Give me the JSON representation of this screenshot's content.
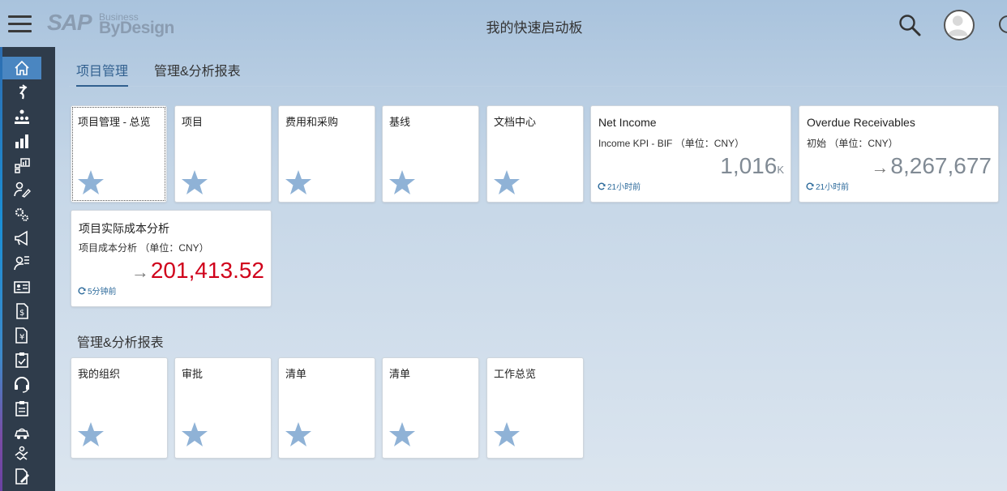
{
  "header": {
    "logo_brand": "SAP",
    "logo_business": "Business",
    "logo_product": "ByDesign",
    "page_title": "我的快速启动板"
  },
  "tabs": [
    {
      "label": "项目管理",
      "active": true
    },
    {
      "label": "管理&分析报表",
      "active": false
    }
  ],
  "tiles_row1": [
    {
      "label": "项目管理 - 总览"
    },
    {
      "label": "项目"
    },
    {
      "label": "费用和采购"
    },
    {
      "label": "基线"
    },
    {
      "label": "文档中心"
    }
  ],
  "kpis": {
    "net_income": {
      "title": "Net Income",
      "subtitle": "Income KPI - BIF （单位：CNY）",
      "value": "1,016",
      "unit": "K",
      "refresh": "21小时前"
    },
    "overdue": {
      "title": "Overdue Receivables",
      "subtitle": "初始 （单位：CNY）",
      "value": "8,267,677",
      "arrow": "→",
      "refresh": "21小时前"
    },
    "project_cost": {
      "title": "项目实际成本分析",
      "subtitle": "项目成本分析 （单位：CNY）",
      "value": "201,413.52",
      "arrow": "→",
      "refresh": "5分钟前",
      "value_color": "#d0021b"
    }
  },
  "section2": {
    "title": "管理&分析报表",
    "tiles": [
      {
        "label": "我的组织"
      },
      {
        "label": "审批"
      },
      {
        "label": "清单"
      },
      {
        "label": "清单"
      },
      {
        "label": "工作总览"
      }
    ]
  },
  "colors": {
    "sidebar_bg": "#2f3c4b",
    "sidebar_active": "#4a86c1",
    "star": "#8fb2d6",
    "tab_active": "#31608f",
    "kpi_negative": "#d0021b"
  }
}
